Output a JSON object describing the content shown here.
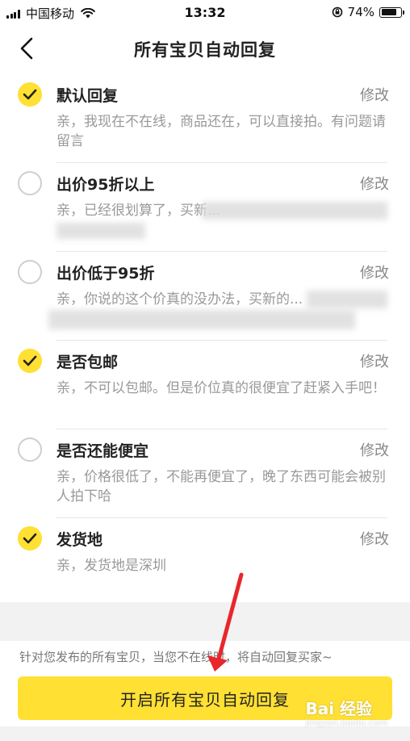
{
  "status_bar": {
    "carrier": "中国移动",
    "time": "13:32",
    "battery_pct": "74%",
    "battery_level": 0.74,
    "icons": [
      "signal-icon",
      "wifi-icon",
      "rotation-lock-icon",
      "battery-icon"
    ]
  },
  "header": {
    "title": "所有宝贝自动回复",
    "back_icon": "chevron-left-icon"
  },
  "edit_label": "修改",
  "items": [
    {
      "title": "默认回复",
      "checked": true,
      "desc": "亲，我现在不在线，商品还在，可以直接拍。有问题请留言"
    },
    {
      "title": "出价95折以上",
      "checked": false,
      "desc": "亲，已经很划算了，买新..."
    },
    {
      "title": "出价低于95折",
      "checked": false,
      "desc": "亲，你说的这个价真的没办法，买新的..."
    },
    {
      "title": "是否包邮",
      "checked": true,
      "desc": "亲，不可以包邮。但是价位真的很便宜了赶紧入手吧！"
    },
    {
      "title": "是否还能便宜",
      "checked": false,
      "desc": "亲，价格很低了，不能再便宜了，晚了东西可能会被别人拍下哈"
    },
    {
      "title": "发货地",
      "checked": true,
      "desc": "亲，发货地是深圳"
    }
  ],
  "footer": {
    "note": "针对您发布的所有宝贝，当您不在线时，将自动回复买家~",
    "button_label": "开启所有宝贝自动回复"
  },
  "watermark": {
    "text": "Bai 经验",
    "sub": "jingyan.baidu.com"
  },
  "colors": {
    "accent": "#ffe033",
    "annotation": "#e8272a"
  }
}
